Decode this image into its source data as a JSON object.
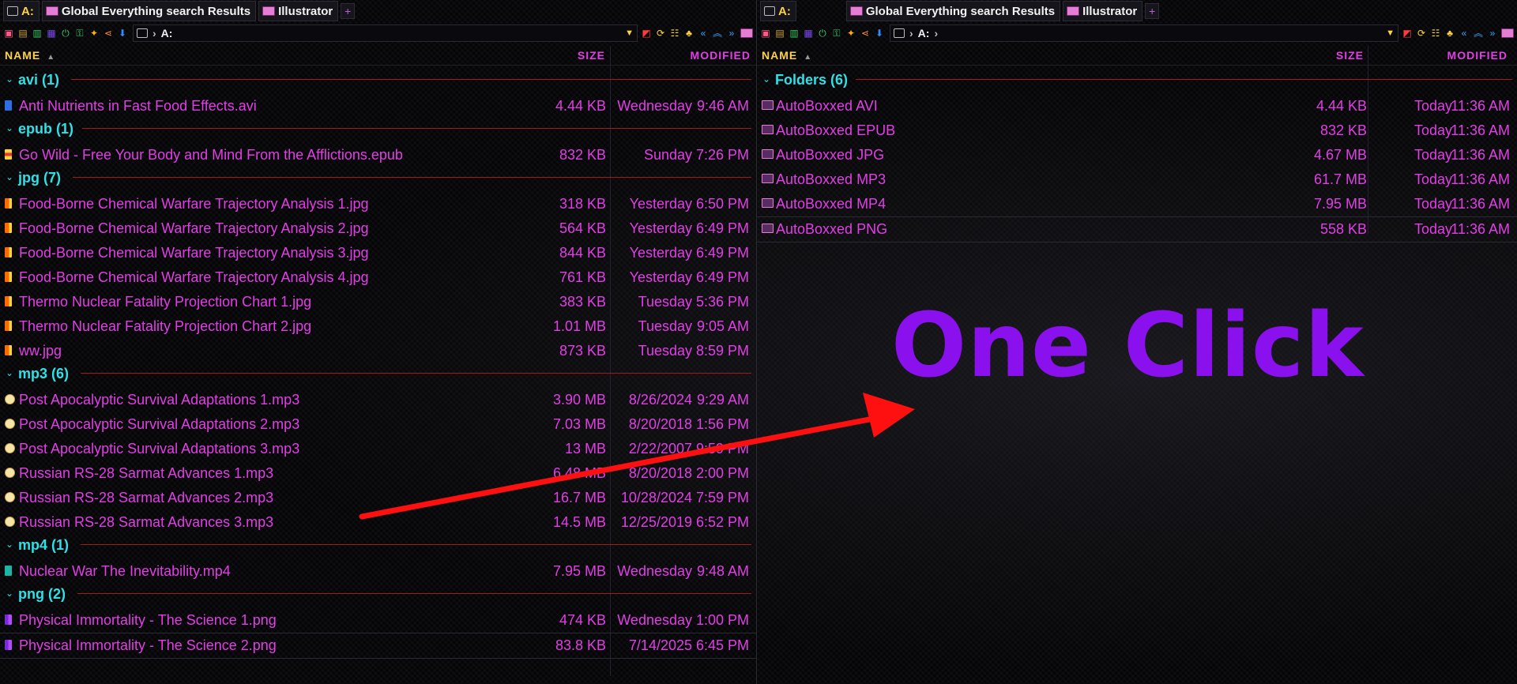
{
  "colors": {
    "accent": "#e23ee6",
    "header_yellow": "#ffd43b",
    "group_cyan": "#2fe0e6",
    "divider_red": "#a11d1d",
    "overlay_purple": "#8a10ee",
    "arrow_red": "#ff1010"
  },
  "left": {
    "tabs": [
      {
        "label": "A:",
        "icon": "drive-icon"
      },
      {
        "label": "Global Everything search Results",
        "icon": "folder-icon"
      },
      {
        "label": "Illustrator",
        "icon": "folder-icon"
      }
    ],
    "address": {
      "path": "A:"
    },
    "columns": {
      "name": "NAME",
      "size": "SIZE",
      "modified": "MODIFIED"
    },
    "groups": [
      {
        "label": "avi (1)",
        "items": [
          {
            "name": "Anti Nutrients in Fast Food Effects.avi",
            "size": "4.44 KB",
            "date": "Wednesday",
            "time": "9:46 AM",
            "icon": "avi"
          }
        ]
      },
      {
        "label": "epub (1)",
        "items": [
          {
            "name": "Go Wild - Free Your Body and Mind From the Afflictions.epub",
            "size": "832 KB",
            "date": "Sunday",
            "time": "7:26 PM",
            "icon": "epub"
          }
        ]
      },
      {
        "label": "jpg (7)",
        "items": [
          {
            "name": "Food-Borne Chemical Warfare Trajectory Analysis 1.jpg",
            "size": "318 KB",
            "date": "Yesterday",
            "time": "6:50 PM",
            "icon": "jpg"
          },
          {
            "name": "Food-Borne Chemical Warfare Trajectory Analysis 2.jpg",
            "size": "564 KB",
            "date": "Yesterday",
            "time": "6:49 PM",
            "icon": "jpg"
          },
          {
            "name": "Food-Borne Chemical Warfare Trajectory Analysis 3.jpg",
            "size": "844 KB",
            "date": "Yesterday",
            "time": "6:49 PM",
            "icon": "jpg"
          },
          {
            "name": "Food-Borne Chemical Warfare Trajectory Analysis 4.jpg",
            "size": "761 KB",
            "date": "Yesterday",
            "time": "6:49 PM",
            "icon": "jpg"
          },
          {
            "name": "Thermo Nuclear Fatality Projection Chart 1.jpg",
            "size": "383 KB",
            "date": "Tuesday",
            "time": "5:36 PM",
            "icon": "jpg"
          },
          {
            "name": "Thermo Nuclear Fatality Projection Chart 2.jpg",
            "size": "1.01 MB",
            "date": "Tuesday",
            "time": "9:05 AM",
            "icon": "jpg"
          },
          {
            "name": "ww.jpg",
            "size": "873 KB",
            "date": "Tuesday",
            "time": "8:59 PM",
            "icon": "jpg"
          }
        ]
      },
      {
        "label": "mp3 (6)",
        "items": [
          {
            "name": "Post Apocalyptic Survival Adaptations 1.mp3",
            "size": "3.90 MB",
            "date": "8/26/2024",
            "time": "9:29 AM",
            "icon": "mp3"
          },
          {
            "name": "Post Apocalyptic Survival Adaptations 2.mp3",
            "size": "7.03 MB",
            "date": "8/20/2018",
            "time": "1:56 PM",
            "icon": "mp3"
          },
          {
            "name": "Post Apocalyptic Survival Adaptations 3.mp3",
            "size": "13 MB",
            "date": "2/22/2007",
            "time": "9:59 PM",
            "icon": "mp3"
          },
          {
            "name": "Russian RS-28 Sarmat Advances 1.mp3",
            "size": "6.48 MB",
            "date": "8/20/2018",
            "time": "2:00 PM",
            "icon": "mp3"
          },
          {
            "name": "Russian RS-28 Sarmat Advances 2.mp3",
            "size": "16.7 MB",
            "date": "10/28/2024",
            "time": "7:59 PM",
            "icon": "mp3"
          },
          {
            "name": "Russian RS-28 Sarmat Advances 3.mp3",
            "size": "14.5 MB",
            "date": "12/25/2019",
            "time": "6:52 PM",
            "icon": "mp3"
          }
        ]
      },
      {
        "label": "mp4 (1)",
        "items": [
          {
            "name": "Nuclear War The Inevitability.mp4",
            "size": "7.95 MB",
            "date": "Wednesday",
            "time": "9:48 AM",
            "icon": "mp4"
          }
        ]
      },
      {
        "label": "png (2)",
        "items": [
          {
            "name": "Physical Immortality - The Science 1.png",
            "size": "474 KB",
            "date": "Wednesday",
            "time": "1:00 PM",
            "icon": "png"
          },
          {
            "name": "Physical Immortality - The Science 2.png",
            "size": "83.8 KB",
            "date": "7/14/2025",
            "time": "6:45 PM",
            "icon": "png"
          }
        ]
      }
    ]
  },
  "right": {
    "tabs": [
      {
        "label": "A:",
        "icon": "drive-icon"
      },
      {
        "label": "Global Everything search Results",
        "icon": "folder-icon"
      },
      {
        "label": "Illustrator",
        "icon": "folder-icon"
      }
    ],
    "address": {
      "path": "A:"
    },
    "columns": {
      "name": "NAME",
      "size": "SIZE",
      "modified": "MODIFIED"
    },
    "groups": [
      {
        "label": "Folders (6)",
        "items": [
          {
            "name": "AutoBoxxed AVI",
            "size": "4.44 KB",
            "date": "Today",
            "time": "11:36 AM",
            "icon": "fold"
          },
          {
            "name": "AutoBoxxed EPUB",
            "size": "832 KB",
            "date": "Today",
            "time": "11:36 AM",
            "icon": "fold"
          },
          {
            "name": "AutoBoxxed JPG",
            "size": "4.67 MB",
            "date": "Today",
            "time": "11:36 AM",
            "icon": "fold"
          },
          {
            "name": "AutoBoxxed MP3",
            "size": "61.7 MB",
            "date": "Today",
            "time": "11:36 AM",
            "icon": "fold"
          },
          {
            "name": "AutoBoxxed MP4",
            "size": "7.95 MB",
            "date": "Today",
            "time": "11:36 AM",
            "icon": "fold"
          },
          {
            "name": "AutoBoxxed PNG",
            "size": "558 KB",
            "date": "Today",
            "time": "11:36 AM",
            "icon": "fold"
          }
        ]
      }
    ]
  },
  "overlay": {
    "text": "One Click"
  }
}
